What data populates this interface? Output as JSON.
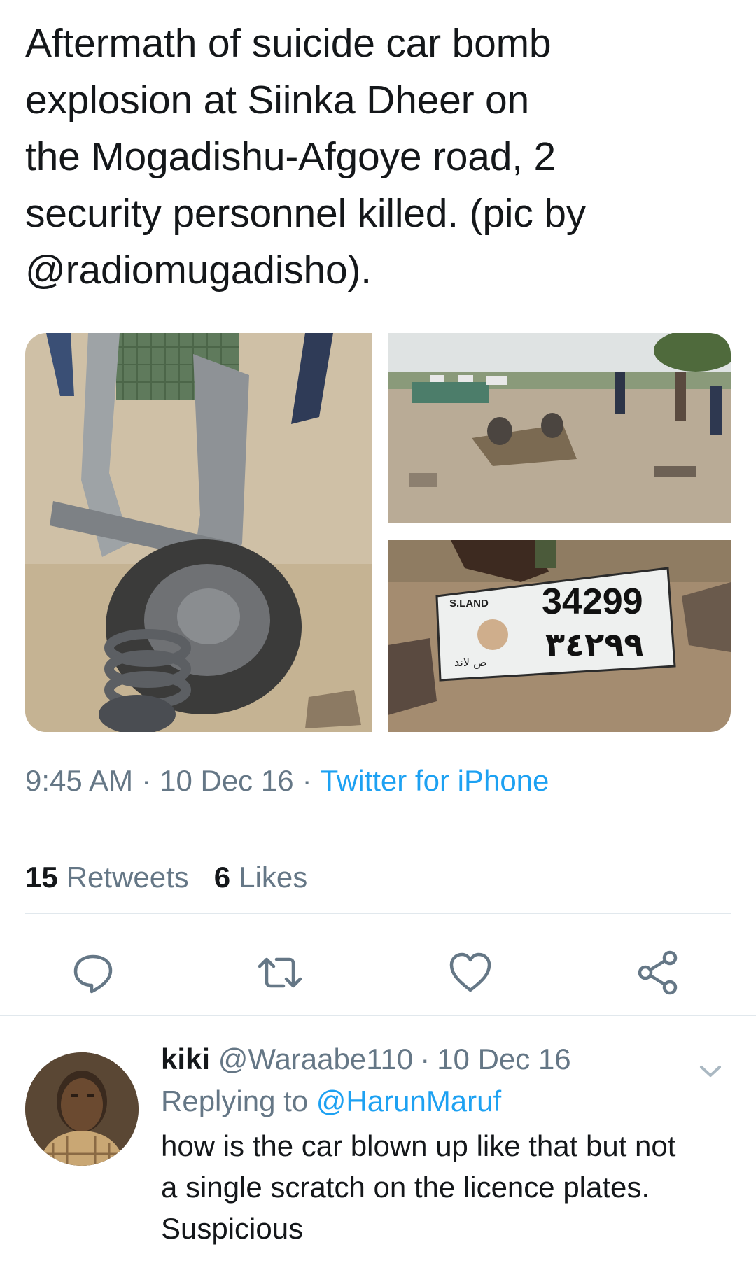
{
  "tweet": {
    "text_lines": [
      "Aftermath of suicide car bomb",
      "explosion at Siinka Dheer on",
      "the Mogadishu-Afgoye road, 2",
      "security personnel killed. (pic by",
      "@radiomugadisho)."
    ],
    "time": "9:45 AM",
    "date": "10 Dec 16",
    "separator": "·",
    "source": "Twitter for iPhone",
    "retweets_count": "15",
    "retweets_label": "Retweets",
    "likes_count": "6",
    "likes_label": "Likes",
    "plate": {
      "brand": "S.LAND",
      "number": "34299",
      "arabic_number": "٣٤٢٩٩",
      "arabic_text": "ص لاند"
    }
  },
  "actions": [
    {
      "name": "reply",
      "icon": "reply-icon"
    },
    {
      "name": "retweet",
      "icon": "retweet-icon"
    },
    {
      "name": "like",
      "icon": "heart-icon"
    },
    {
      "name": "share",
      "icon": "share-icon"
    }
  ],
  "reply": {
    "name": "kiki",
    "handle": "@Waraabe110",
    "separator": "·",
    "date": "10 Dec 16",
    "replying_label": "Replying to",
    "replying_to": "@HarunMaruf",
    "text_lines": [
      "how is the car blown up like that but not",
      "a single scratch on the licence plates.",
      "Suspicious"
    ]
  },
  "colors": {
    "text": "#14171a",
    "secondary": "#657786",
    "link": "#1da1f2",
    "divider": "#e1e8ed"
  }
}
